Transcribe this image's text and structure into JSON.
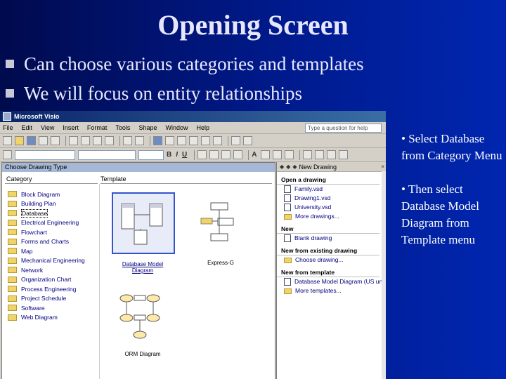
{
  "slide": {
    "title": "Opening Screen",
    "bullets": [
      "Can choose various categories and templates",
      "We will focus on entity relationships"
    ],
    "notes": [
      "• Select Database from Category Menu",
      "• Then select Database Model Diagram from Template menu"
    ]
  },
  "window": {
    "title": "Microsoft Visio",
    "menu": [
      "File",
      "Edit",
      "View",
      "Insert",
      "Format",
      "Tools",
      "Shape",
      "Window",
      "Help"
    ],
    "help_placeholder": "Type a question for help"
  },
  "choose_drawing": {
    "header": "Choose Drawing Type",
    "category_label": "Category",
    "template_label": "Template",
    "categories": [
      "Block Diagram",
      "Building Plan",
      "Database",
      "Electrical Engineering",
      "Flowchart",
      "Forms and Charts",
      "Map",
      "Mechanical Engineering",
      "Network",
      "Organization Chart",
      "Process Engineering",
      "Project Schedule",
      "Software",
      "Web Diagram"
    ],
    "selected_category": "Database",
    "templates": [
      "Database Model Diagram",
      "Express-G",
      "ORM Diagram"
    ]
  },
  "task_pane": {
    "title": "New Drawing",
    "open_section": "Open a drawing",
    "open_items": [
      "Family.vsd",
      "Drawing1.vsd",
      "University.vsd",
      "More drawings..."
    ],
    "new_section": "New",
    "new_items": [
      "Blank drawing"
    ],
    "existing_section": "New from existing drawing",
    "existing_items": [
      "Choose drawing..."
    ],
    "template_section": "New from template",
    "template_items": [
      "Database Model Diagram (US units)",
      "More templates..."
    ]
  },
  "colors": {
    "slide_bg": "#001a8c",
    "title_text": "#e6e6ff",
    "window_chrome": "#d4d0c8",
    "link_blue": "#000080",
    "titlebar": "#0a246a"
  }
}
